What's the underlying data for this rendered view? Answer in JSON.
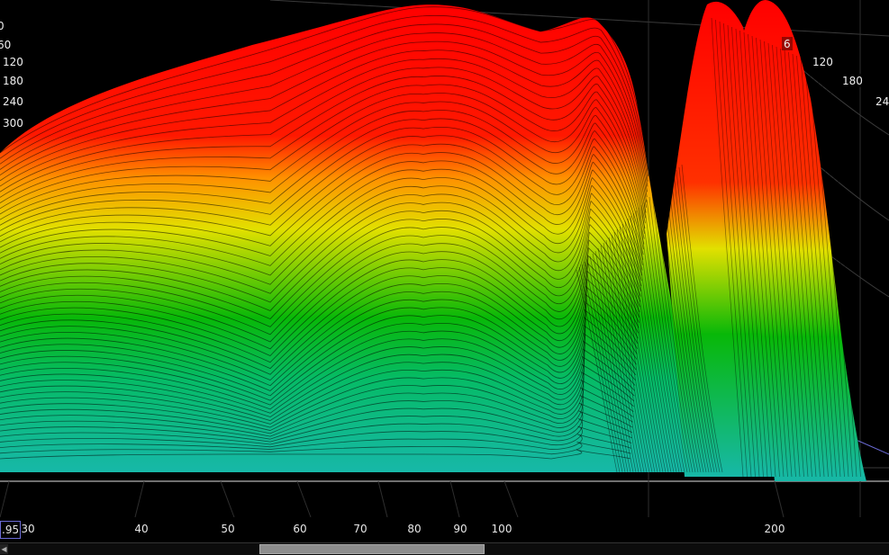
{
  "chart_data": {
    "type": "waterfall-3d",
    "x_axis": {
      "min_value_shown": ".95",
      "tick_labels": [
        "30",
        "40",
        "50",
        "60",
        "70",
        "80",
        "90",
        "100",
        "200"
      ],
      "scale": "log"
    },
    "depth_axis": {
      "left_labels": [
        "0",
        "60",
        "120",
        "180",
        "240",
        "300"
      ],
      "right_labels": [
        "6",
        "120",
        "180",
        "24"
      ]
    },
    "colors": {
      "low": "#17b8a8",
      "mid_low": "#10b810",
      "mid": "#e0e000",
      "high": "#ff0000",
      "background": "#000000",
      "grid": "#3a3a3a"
    },
    "grid": true,
    "slices": 56
  }
}
